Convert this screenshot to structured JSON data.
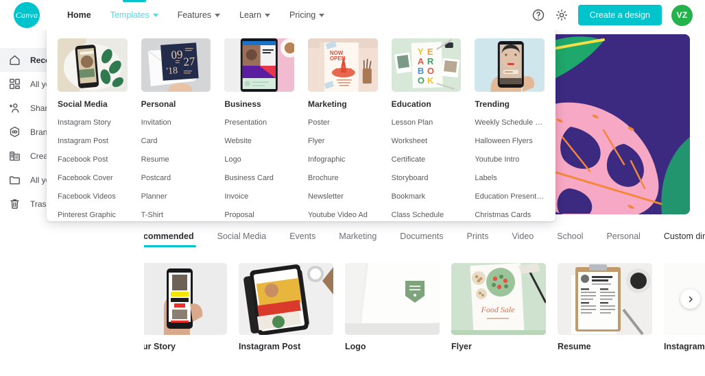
{
  "header": {
    "logo_text": "Canva",
    "nav": [
      {
        "label": "Home",
        "has_caret": false,
        "state": "active"
      },
      {
        "label": "Templates",
        "has_caret": true,
        "state": "open"
      },
      {
        "label": "Features",
        "has_caret": true,
        "state": "normal"
      },
      {
        "label": "Learn",
        "has_caret": true,
        "state": "normal"
      },
      {
        "label": "Pricing",
        "has_caret": true,
        "state": "normal"
      }
    ],
    "help_icon": "help-circle-icon",
    "settings_icon": "gear-icon",
    "create_button": "Create a design",
    "avatar_initials": "VZ",
    "accent_color": "#00c4cc",
    "avatar_color": "#24b24c"
  },
  "sidebar": {
    "items": [
      {
        "label": "Recommended",
        "icon": "home-icon",
        "selected": true
      },
      {
        "label": "All your designs",
        "icon": "grid-icon",
        "selected": false
      },
      {
        "label": "Shared with you",
        "icon": "share-person-icon",
        "selected": false
      },
      {
        "label": "Brand Kit",
        "icon": "brand-hexagon-icon",
        "selected": false
      },
      {
        "label": "Create a team",
        "icon": "team-building-icon",
        "selected": false
      },
      {
        "label": "All your folders",
        "icon": "folder-icon",
        "selected": false
      },
      {
        "label": "Trash",
        "icon": "trash-icon",
        "selected": false
      }
    ]
  },
  "dropdown": {
    "columns": [
      {
        "title": "Social Media",
        "thumb": "phone-instagram-story-photo",
        "links": [
          "Instagram Story",
          "Instagram Post",
          "Facebook Post",
          "Facebook Cover",
          "Facebook Videos",
          "Pinterest Graphic"
        ]
      },
      {
        "title": "Personal",
        "thumb": "navy-date-invitation-card",
        "links": [
          "Invitation",
          "Card",
          "Resume",
          "Postcard",
          "Planner",
          "T-Shirt"
        ]
      },
      {
        "title": "Business",
        "thumb": "phone-pink-business-post",
        "links": [
          "Presentation",
          "Website",
          "Logo",
          "Business Card",
          "Invoice",
          "Proposal"
        ]
      },
      {
        "title": "Marketing",
        "thumb": "now-open-poster",
        "links": [
          "Poster",
          "Flyer",
          "Infographic",
          "Brochure",
          "Newsletter",
          "Youtube Video Ad"
        ]
      },
      {
        "title": "Education",
        "thumb": "yearbook-cover",
        "links": [
          "Lesson Plan",
          "Worksheet",
          "Certificate",
          "Storyboard",
          "Bookmark",
          "Class Schedule"
        ]
      },
      {
        "title": "Trending",
        "thumb": "hand-holding-phone-portrait",
        "links": [
          "Weekly Schedule Pla...",
          "Halloween Flyers",
          "Youtube Intro",
          "Labels",
          "Education Presentati...",
          "Christmas Cards"
        ]
      }
    ]
  },
  "tabs": {
    "items": [
      {
        "label": "Recommended",
        "active": true
      },
      {
        "label": "Social Media",
        "active": false
      },
      {
        "label": "Events",
        "active": false
      },
      {
        "label": "Marketing",
        "active": false
      },
      {
        "label": "Documents",
        "active": false
      },
      {
        "label": "Prints",
        "active": false
      },
      {
        "label": "Video",
        "active": false
      },
      {
        "label": "School",
        "active": false
      },
      {
        "label": "Personal",
        "active": false
      }
    ],
    "custom_dimensions": "Custom dimensions"
  },
  "cards": [
    {
      "label": "Your Story",
      "thumb": "hand-phone-birthday-sale"
    },
    {
      "label": "Instagram Post",
      "thumb": "phone-midyear-sale-notebook"
    },
    {
      "label": "Logo",
      "thumb": "green-fresh-co-logo-card"
    },
    {
      "label": "Flyer",
      "thumb": "food-sale-flyer-salad"
    },
    {
      "label": "Resume",
      "thumb": "clipboard-resume-coffee"
    },
    {
      "label": "Instagram",
      "thumb": "partial-card"
    }
  ],
  "carousel": {
    "next_icon": "chevron-right-icon"
  },
  "hero": {
    "background_colors": [
      "#3b2a80",
      "#f4a6c0",
      "#1fa86b",
      "#f5873a",
      "#2ec6c6",
      "#f5e04a"
    ]
  }
}
